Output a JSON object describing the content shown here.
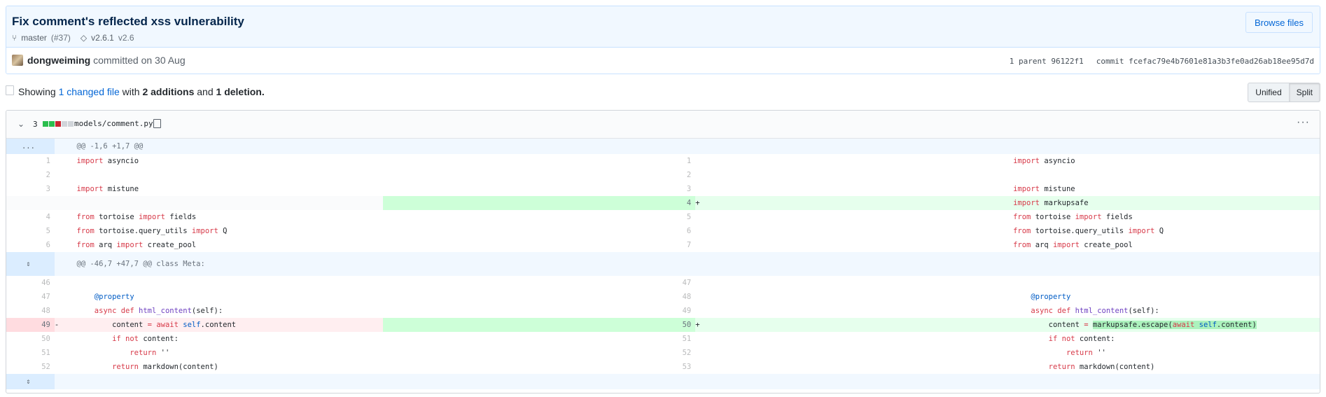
{
  "commit": {
    "title": "Fix comment's reflected xss vulnerability",
    "branch": "master",
    "pr": "(#37)",
    "tag": "v2.6.1",
    "tag_extra": "v2.6",
    "browse_label": "Browse files",
    "author": "dongweiming",
    "action": "committed on 30 Aug",
    "parent_label": "1 parent",
    "parent_sha": "96122f1",
    "commit_label": "commit",
    "commit_sha": "fcefac79e4b7601e81a3b3fe0ad26ab18ee95d7d"
  },
  "toolbar": {
    "showing": "Showing",
    "changed": "1 changed file",
    "with": "with",
    "additions": "2 additions",
    "and": "and",
    "deletions": "1 deletion.",
    "unified": "Unified",
    "split": "Split"
  },
  "file": {
    "changes": "3",
    "name": "models/comment.py",
    "diffstat_colors": [
      "#2cbe4e",
      "#2cbe4e",
      "#cb2431",
      "#d1d5da",
      "#d1d5da"
    ]
  },
  "diff": {
    "hunk1": "@@ -1,6 +1,7 @@",
    "hunk2": "@@ -46,7 +47,7 @@ class Meta:",
    "hunk1_expander": "...",
    "left_nums": [
      "1",
      "2",
      "3",
      "",
      "4",
      "5",
      "6"
    ],
    "right_nums": [
      "1",
      "2",
      "3",
      "4",
      "5",
      "6",
      "7"
    ],
    "left2_nums": [
      "46",
      "47",
      "48",
      "49",
      "50",
      "51",
      "52"
    ],
    "right2_nums": [
      "47",
      "48",
      "49",
      "50",
      "51",
      "52",
      "53"
    ],
    "plus": "+",
    "minus": "-"
  }
}
